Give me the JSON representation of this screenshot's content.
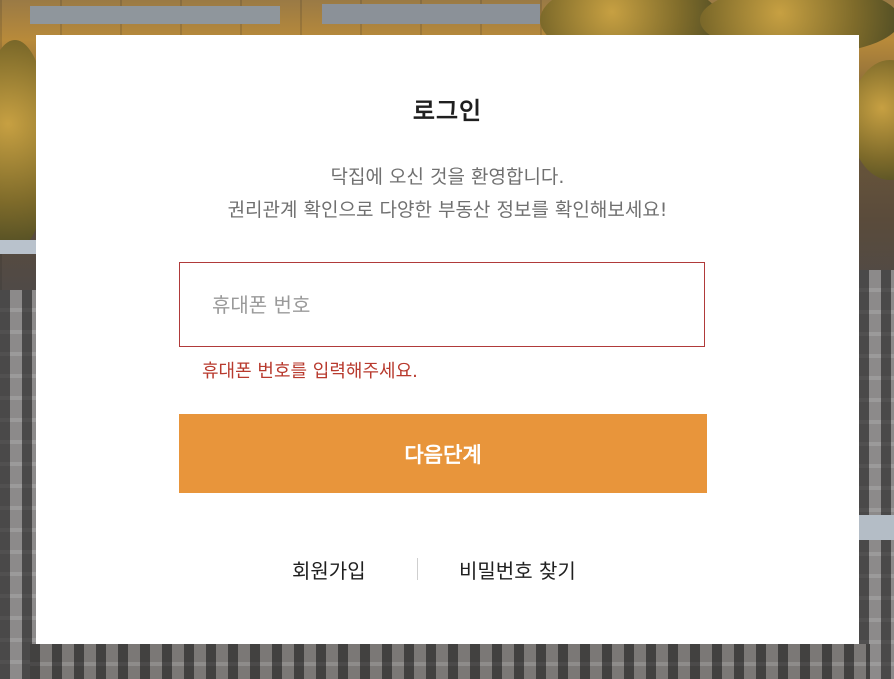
{
  "login": {
    "title": "로그인",
    "welcome_line1": "닥집에 오신 것을 환영합니다.",
    "welcome_line2": "권리관계 확인으로 다양한 부동산 정보를 확인해보세요!",
    "phone_field": {
      "placeholder": "휴대폰 번호",
      "value": ""
    },
    "error_message": "휴대폰 번호를 입력해주세요.",
    "next_button": "다음단계",
    "signup_link": "회원가입",
    "find_password_link": "비밀번호 찾기"
  },
  "colors": {
    "accent": "#e8953b",
    "error": "#b83a2e",
    "text": "#1f1f1f",
    "muted": "#707070"
  }
}
